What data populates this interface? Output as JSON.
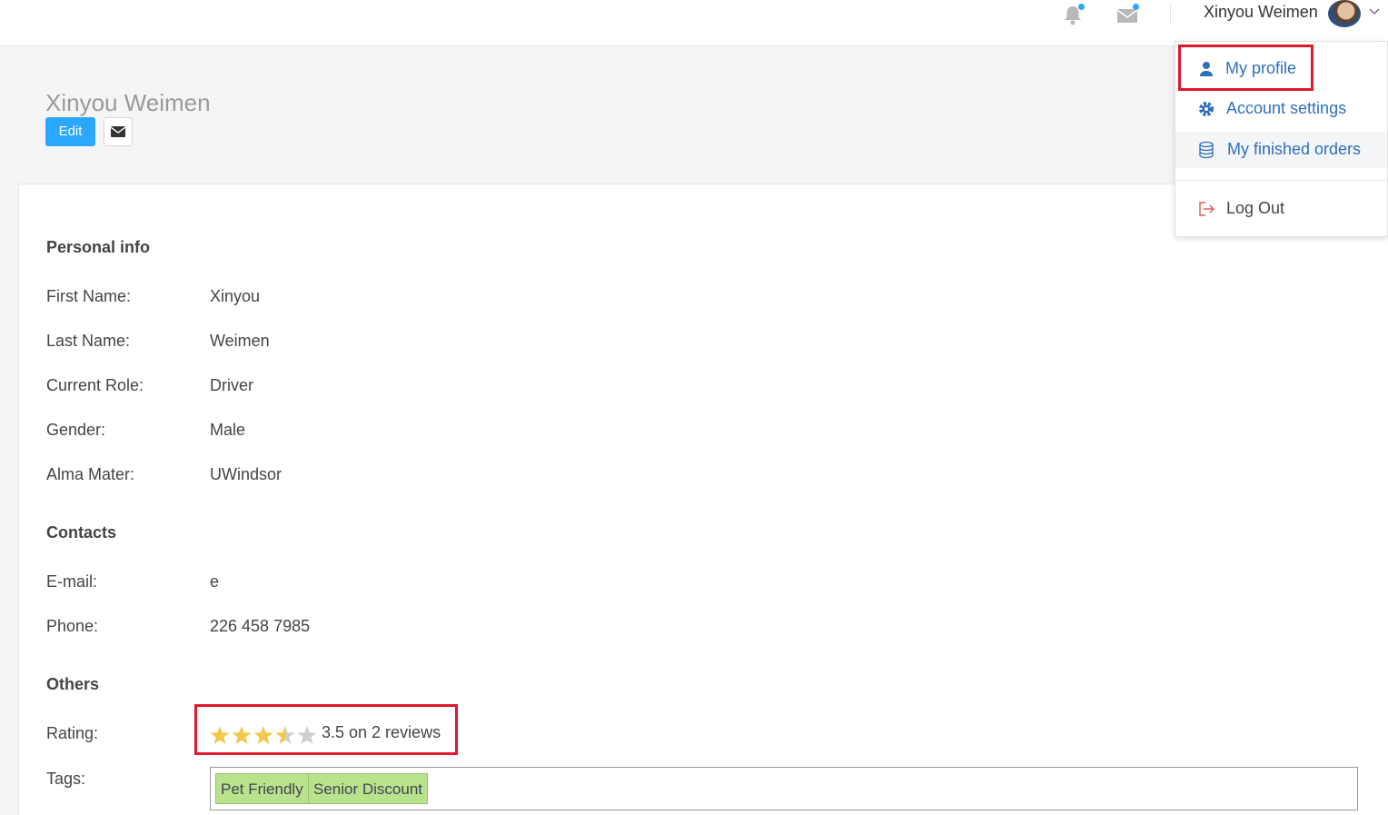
{
  "topbar": {
    "user_name": "Xinyou Weimen",
    "icons": [
      "bell-icon",
      "envelope-icon",
      "avatar",
      "chevron-down-icon"
    ],
    "accent_color": "#2aa7ff"
  },
  "header": {
    "title": "Xinyou Weimen",
    "edit_label": "Edit"
  },
  "personal_info": {
    "heading": "Personal info",
    "fields": [
      {
        "label": "First Name:",
        "value": "Xinyou"
      },
      {
        "label": "Last Name:",
        "value": "Weimen"
      },
      {
        "label": "Current Role:",
        "value": "Driver"
      },
      {
        "label": "Gender:",
        "value": "Male"
      },
      {
        "label": "Alma Mater:",
        "value": "UWindsor"
      }
    ]
  },
  "contacts": {
    "heading": "Contacts",
    "fields": [
      {
        "label": "E-mail:",
        "value": "e"
      },
      {
        "label": "Phone:",
        "value": "226 458 7985"
      }
    ]
  },
  "others": {
    "heading": "Others",
    "rating_label": "Rating:",
    "rating_value": 3.5,
    "rating_max": 5,
    "rating_text": "3.5 on 2 reviews",
    "tags_label": "Tags:",
    "tags": [
      "Pet Friendly",
      "Senior Discount"
    ]
  },
  "dropdown": {
    "items": [
      {
        "label": "My profile",
        "icon": "user-icon"
      },
      {
        "label": "Account settings",
        "icon": "gear-icon"
      },
      {
        "label": "My finished orders",
        "icon": "database-icon"
      },
      {
        "label": "Log Out",
        "icon": "logout-icon"
      }
    ]
  },
  "colors": {
    "highlight_box": "#e0182a",
    "star": "#f2c94c",
    "tag_bg": "#b9e28c",
    "link": "#2f6fbe"
  }
}
